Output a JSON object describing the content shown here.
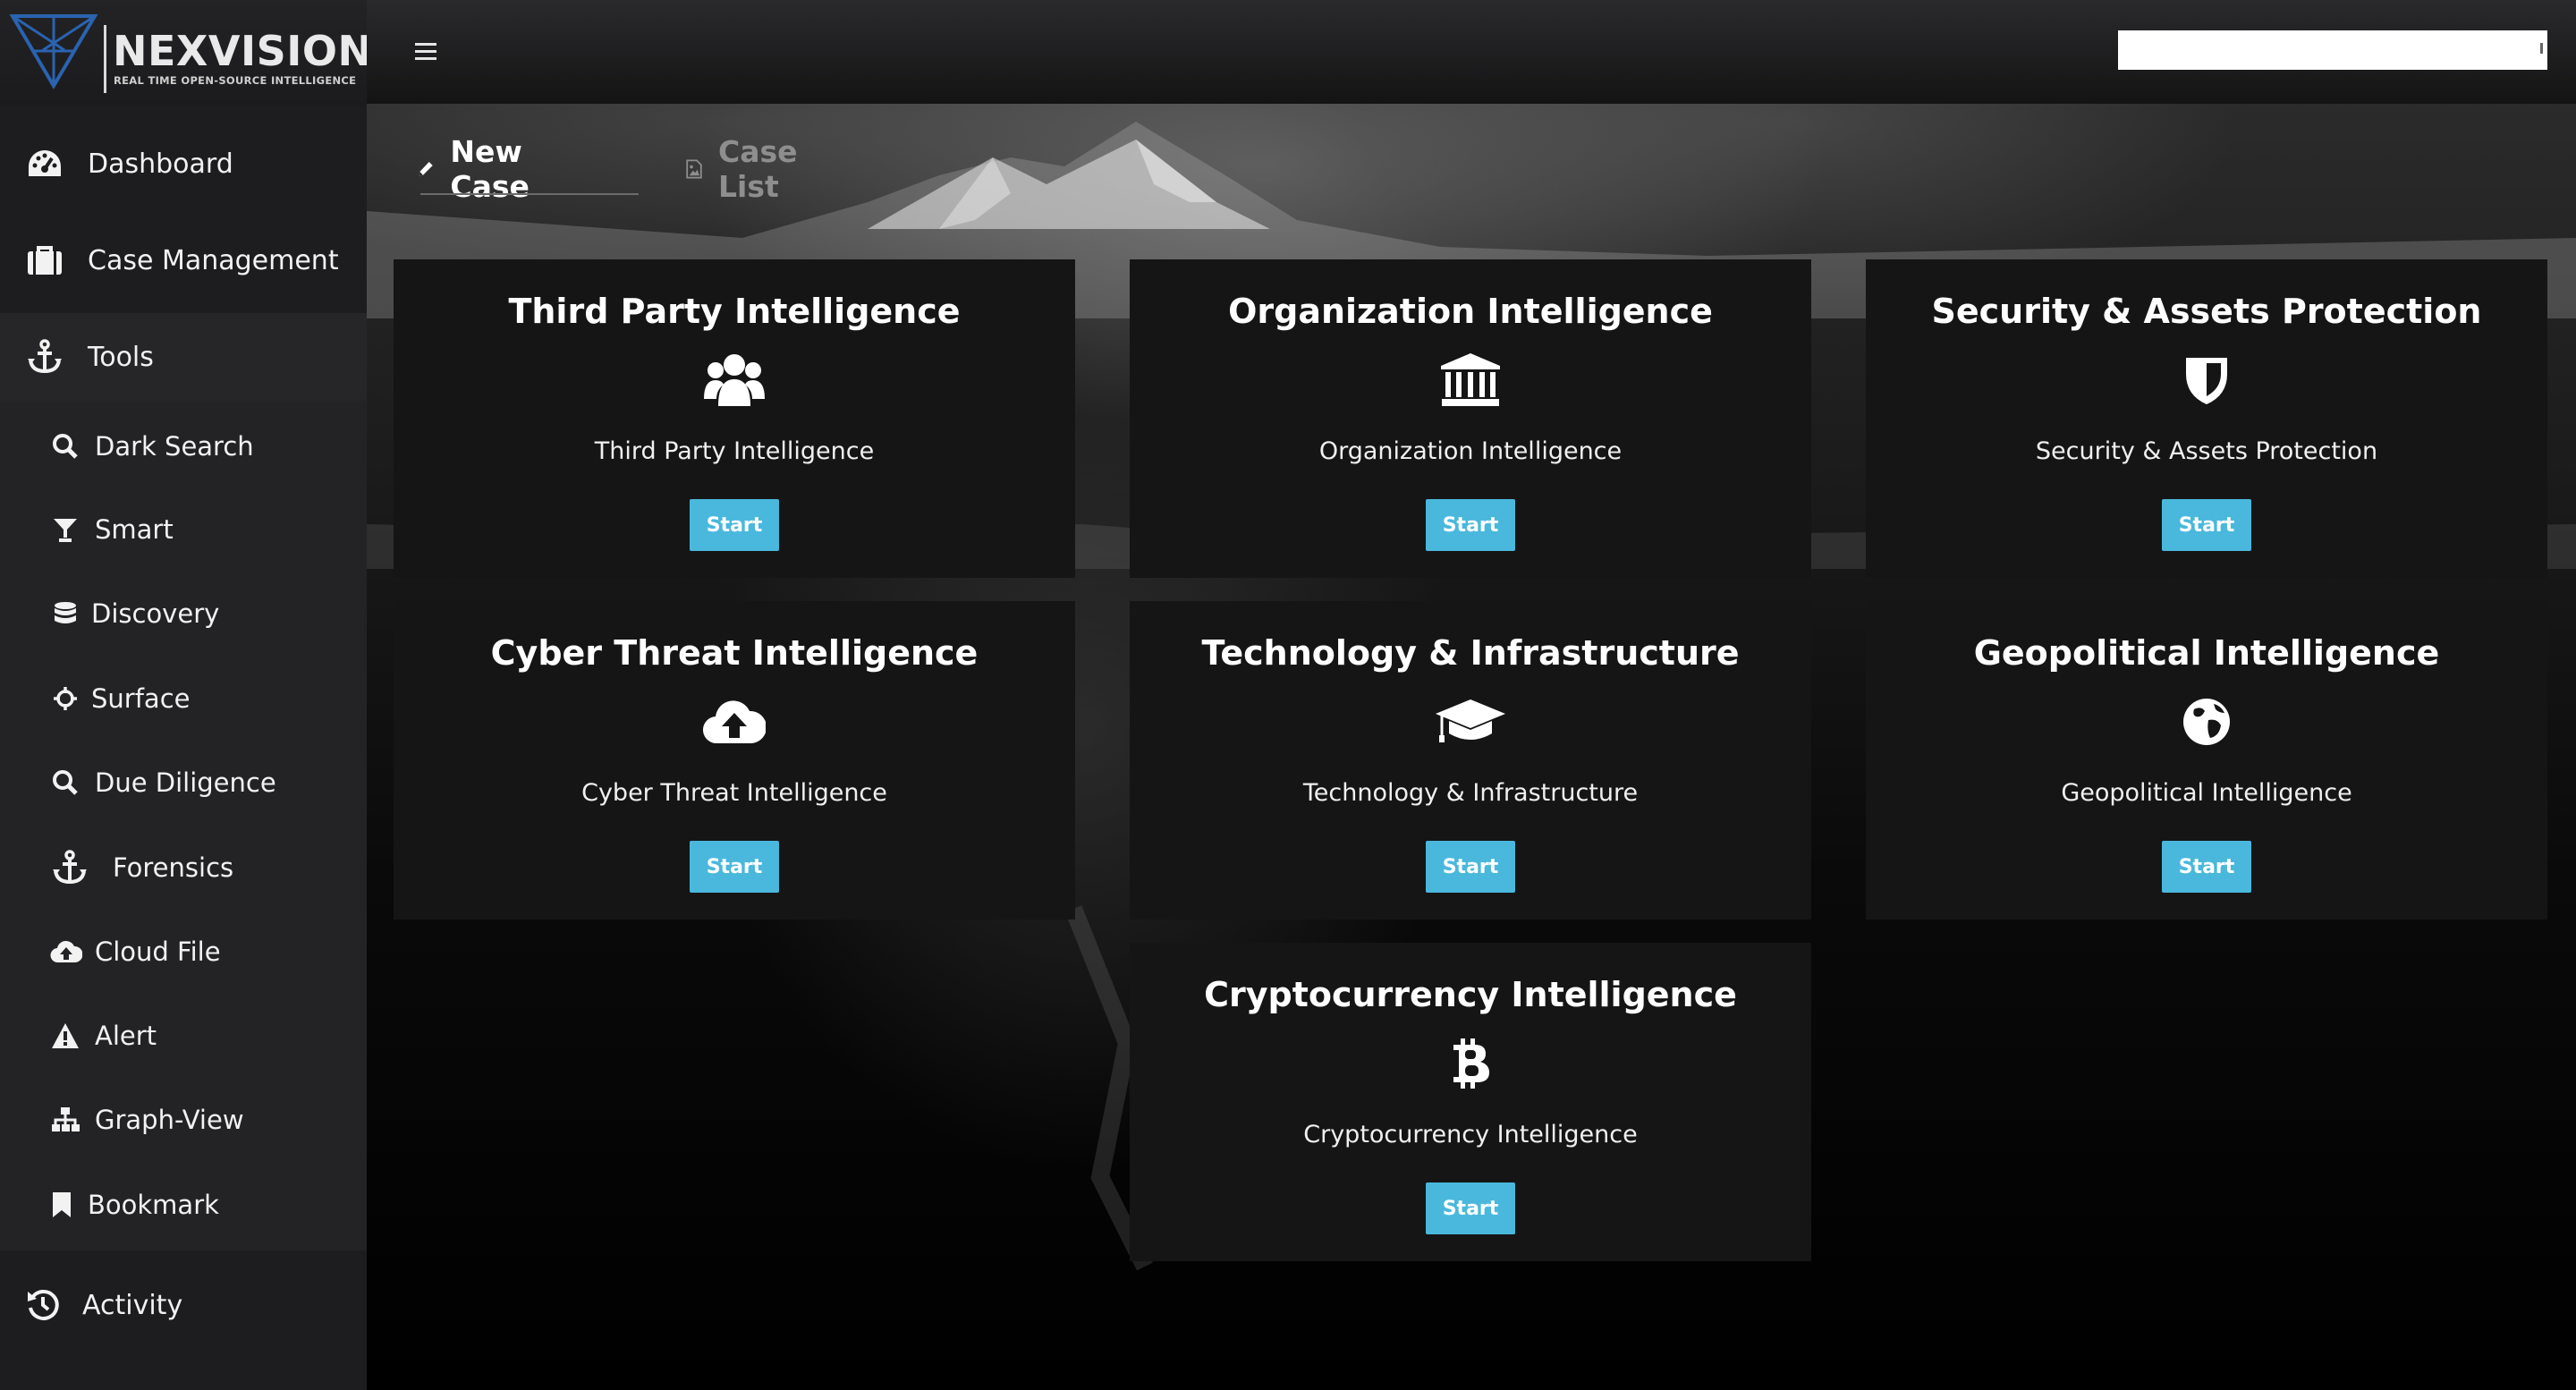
{
  "brand": {
    "name": "NEXVISION",
    "tagline": "REAL TIME OPEN-SOURCE INTELLIGENCE"
  },
  "sidebar": {
    "items": [
      {
        "label": "Dashboard",
        "icon": "dashboard-icon"
      },
      {
        "label": "Case Management",
        "icon": "briefcase-icon"
      },
      {
        "label": "Tools",
        "icon": "anchor-icon"
      },
      {
        "label": "Activity",
        "icon": "history-icon"
      }
    ],
    "tools": [
      {
        "label": "Dark Search",
        "icon": "search-icon"
      },
      {
        "label": "Smart",
        "icon": "filter-icon"
      },
      {
        "label": "Discovery",
        "icon": "database-icon"
      },
      {
        "label": "Surface",
        "icon": "crosshair-icon"
      },
      {
        "label": "Due Diligence",
        "icon": "search-icon"
      },
      {
        "label": "Forensics",
        "icon": "anchor-icon"
      },
      {
        "label": "Cloud File",
        "icon": "cloud-upload-icon"
      },
      {
        "label": "Alert",
        "icon": "warning-icon"
      },
      {
        "label": "Graph-View",
        "icon": "sitemap-icon"
      },
      {
        "label": "Bookmark",
        "icon": "bookmark-icon"
      }
    ]
  },
  "header": {
    "menu_icon": "hamburger-icon",
    "search_value": ""
  },
  "case_tabs": [
    {
      "label": "New Case",
      "icon": "pencil-icon",
      "active": true
    },
    {
      "label": "Case List",
      "icon": "image-file-icon",
      "active": false
    }
  ],
  "cards": [
    {
      "title": "Third Party Intelligence",
      "description": "Third Party Intelligence",
      "button": "Start",
      "icon": "users-icon"
    },
    {
      "title": "Organization Intelligence",
      "description": "Organization Intelligence",
      "button": "Start",
      "icon": "bank-icon"
    },
    {
      "title": "Security & Assets Protection",
      "description": "Security & Assets Protection",
      "button": "Start",
      "icon": "shield-icon"
    },
    {
      "title": "Cyber Threat Intelligence",
      "description": "Cyber Threat Intelligence",
      "button": "Start",
      "icon": "cloud-upload-icon"
    },
    {
      "title": "Technology & Infrastructure",
      "description": "Technology & Infrastructure",
      "button": "Start",
      "icon": "graduation-cap-icon"
    },
    {
      "title": "Geopolitical Intelligence",
      "description": "Geopolitical Intelligence",
      "button": "Start",
      "icon": "globe-icon"
    },
    {
      "title": "Cryptocurrency Intelligence",
      "description": "Cryptocurrency Intelligence",
      "button": "Start",
      "icon": "bitcoin-icon"
    }
  ],
  "colors": {
    "accent": "#4ab8dd",
    "sidebar_bg": "#1d1d1f",
    "card_bg": "#151516"
  }
}
